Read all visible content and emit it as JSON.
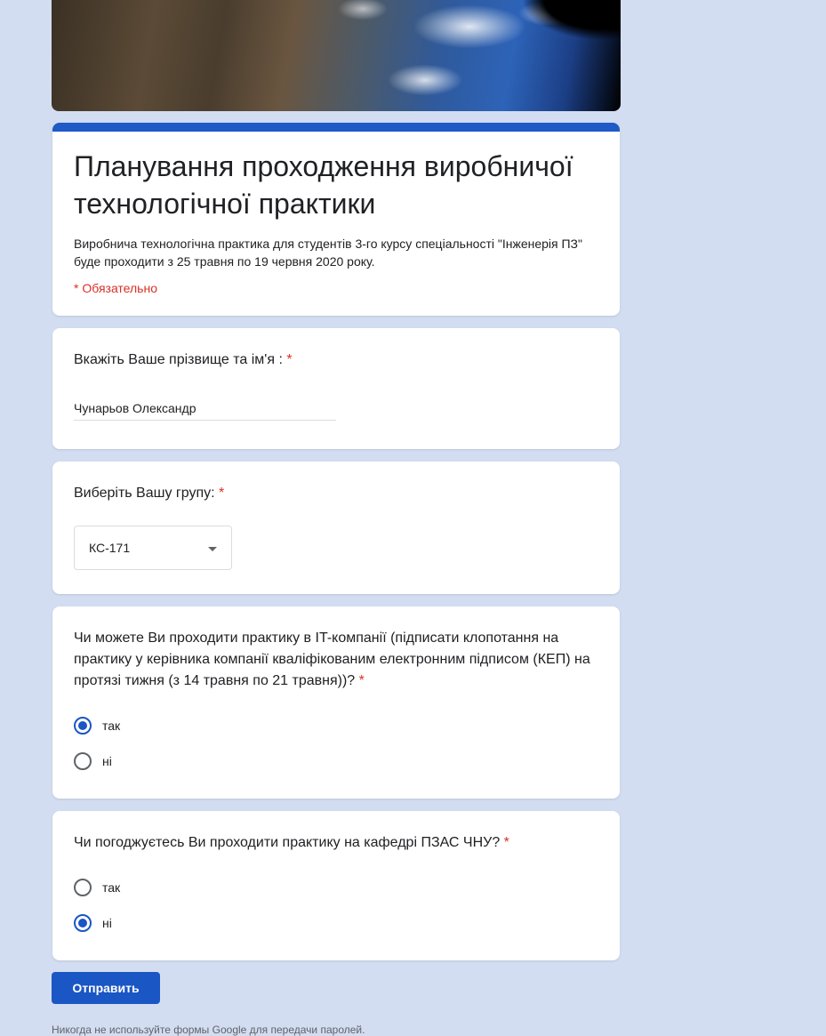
{
  "header_image": {
    "description": "space-earth-banner"
  },
  "form": {
    "title": "Планування проходження виробничої технологічної практики",
    "description": "Виробнича технологічна практика для студентів 3-го курсу спеціальності \"Інженерія ПЗ\" буде проходити з 25 травня по 19 червня 2020 року.",
    "required_note": "* Обязательно",
    "accent_color": "#1f5ac6"
  },
  "questions": {
    "name": {
      "label": "Вкажіть Ваше прізвище та ім'я :",
      "required_mark": "*",
      "value": "Чунарьов Олександр"
    },
    "group": {
      "label": "Виберіть Вашу групу:",
      "required_mark": "*",
      "selected": "КС-171"
    },
    "it_company": {
      "label": "Чи можете Ви проходити практику в IT-компанії (підписати клопотання на практику у керівника компанії кваліфікованим електронним підписом (КЕП) на протязі тижня (з 14 травня по 21 травня))?",
      "required_mark": "*",
      "options": [
        {
          "label": "так",
          "checked": true
        },
        {
          "label": "ні",
          "checked": false
        }
      ]
    },
    "department": {
      "label": "Чи погоджуєтесь Ви проходити практику на кафедрі ПЗАС ЧНУ?",
      "required_mark": "*",
      "options": [
        {
          "label": "так",
          "checked": false
        },
        {
          "label": "ні",
          "checked": true
        }
      ]
    }
  },
  "submit": {
    "label": "Отправить",
    "color": "#1a56c4"
  },
  "footer": {
    "note": "Никогда не используйте формы Google для передачи паролей."
  }
}
